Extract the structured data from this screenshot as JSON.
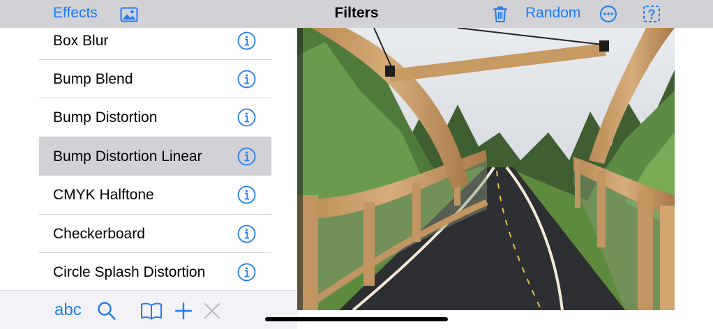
{
  "navbar": {
    "effects_label": "Effects",
    "title": "Filters",
    "random_label": "Random",
    "icons": [
      "photo-library-icon",
      "trash-icon",
      "more-icon",
      "help-icon"
    ]
  },
  "filters": [
    {
      "label": "Box Blur",
      "selected": false
    },
    {
      "label": "Bump Blend",
      "selected": false
    },
    {
      "label": "Bump Distortion",
      "selected": false
    },
    {
      "label": "Bump Distortion Linear",
      "selected": true
    },
    {
      "label": "CMYK Halftone",
      "selected": false
    },
    {
      "label": "Checkerboard",
      "selected": false
    },
    {
      "label": "Circle Splash Distortion",
      "selected": false
    }
  ],
  "toolbar": {
    "abc_label": "abc",
    "icons": [
      "search-icon",
      "book-icon",
      "plus-icon",
      "close-icon"
    ]
  },
  "colors": {
    "accent": "#1e7cf2",
    "nav_background": "#d1d1d6",
    "selected_row": "#d1d1d6",
    "disabled": "#b8b8bd"
  }
}
